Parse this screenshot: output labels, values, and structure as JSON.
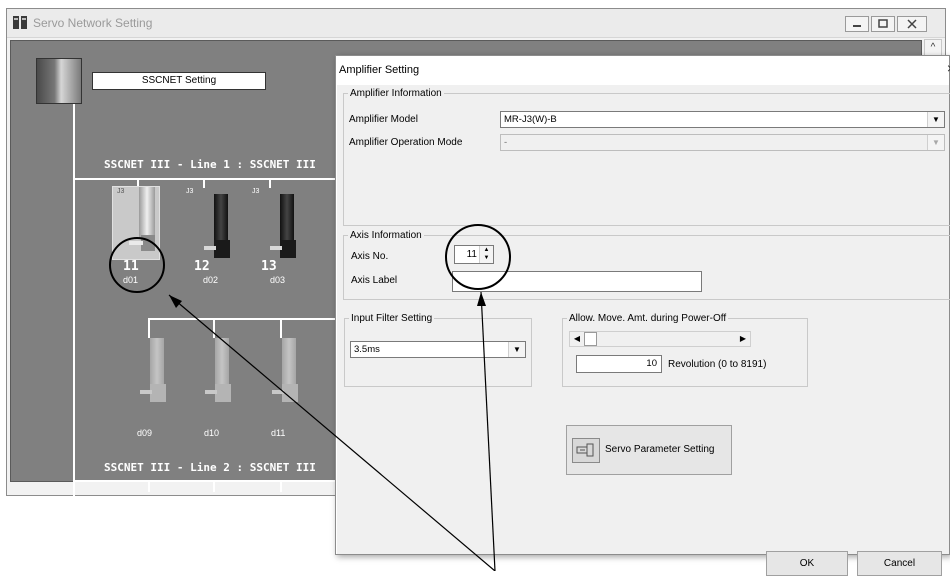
{
  "main_window": {
    "title": "Servo Network Setting",
    "sscnet_button": "SSCNET Setting",
    "scroll_up_glyph": "^",
    "line1_label": "SSCNET III - Line 1 : SSCNET III",
    "line2_label": "SSCNET III - Line 2 : SSCNET III",
    "line1_amplifiers": [
      {
        "tag": "J3",
        "axis": "11",
        "label": "d01",
        "selected": true
      },
      {
        "tag": "J3",
        "axis": "12",
        "label": "d02",
        "selected": false
      },
      {
        "tag": "J3",
        "axis": "13",
        "label": "d03",
        "selected": false
      }
    ],
    "line2_amplifiers": [
      {
        "label": "d09"
      },
      {
        "label": "d10"
      },
      {
        "label": "d11"
      }
    ]
  },
  "dialog": {
    "title": "Amplifier Setting",
    "close_glyph": "×",
    "amplifier_information": {
      "legend": "Amplifier Information",
      "model_label": "Amplifier Model",
      "model_value": "MR-J3(W)-B",
      "operation_mode_label": "Amplifier Operation Mode",
      "operation_mode_value": "-"
    },
    "axis_information": {
      "legend": "Axis Information",
      "axis_no_label": "Axis No.",
      "axis_no_value": "11",
      "axis_label_label": "Axis Label",
      "axis_label_value": ""
    },
    "input_filter": {
      "legend": "Input Filter Setting",
      "value": "3.5ms"
    },
    "allow_move": {
      "legend": "Allow. Move. Amt. during Power-Off",
      "value": "10",
      "unit_text": "Revolution (0 to 8191)",
      "slider_fraction": 0.001
    },
    "servo_param_button": "Servo Parameter Setting",
    "ok_button": "OK",
    "cancel_button": "Cancel"
  },
  "colors": {
    "panel_bg": "#808080",
    "dialog_bg": "#f0f0f0",
    "wire": "#ffffff"
  }
}
